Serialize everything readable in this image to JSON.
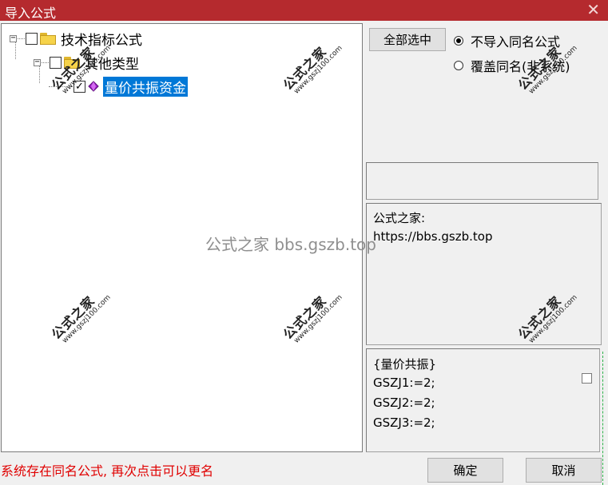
{
  "window": {
    "title": "导入公式",
    "close_glyph": "✕"
  },
  "tree": {
    "nodes": [
      {
        "label": "技术指标公式",
        "expander": "⊟",
        "checked": false
      },
      {
        "label": "其他类型",
        "expander": "⊟",
        "checked": false
      },
      {
        "label": "量价共振资金",
        "expander": "",
        "checked": true,
        "selected": true
      }
    ]
  },
  "options": {
    "select_all_label": "全部选中",
    "radio_no_import": "不导入同名公式",
    "radio_overwrite": "覆盖同名(非系统)",
    "selected": "no_import"
  },
  "description": {
    "line1": "公式之家:",
    "line2": "https://bbs.gszb.top"
  },
  "code": {
    "lines": [
      "{量价共振}",
      "GSZJ1:=2;",
      "GSZJ2:=2;",
      "GSZJ3:=2;"
    ]
  },
  "status": {
    "message": "系统存在同名公式, 再次点击可以更名"
  },
  "buttons": {
    "ok": "确定",
    "cancel": "取消"
  },
  "watermarks": {
    "center": "公式之家 bbs.gszb.top",
    "stamp_title": "公式之家",
    "stamp_url": "www.gszj100.com"
  },
  "colors": {
    "titlebar": "#b52a2e",
    "selection": "#0078d7",
    "status_text": "#e00000"
  }
}
